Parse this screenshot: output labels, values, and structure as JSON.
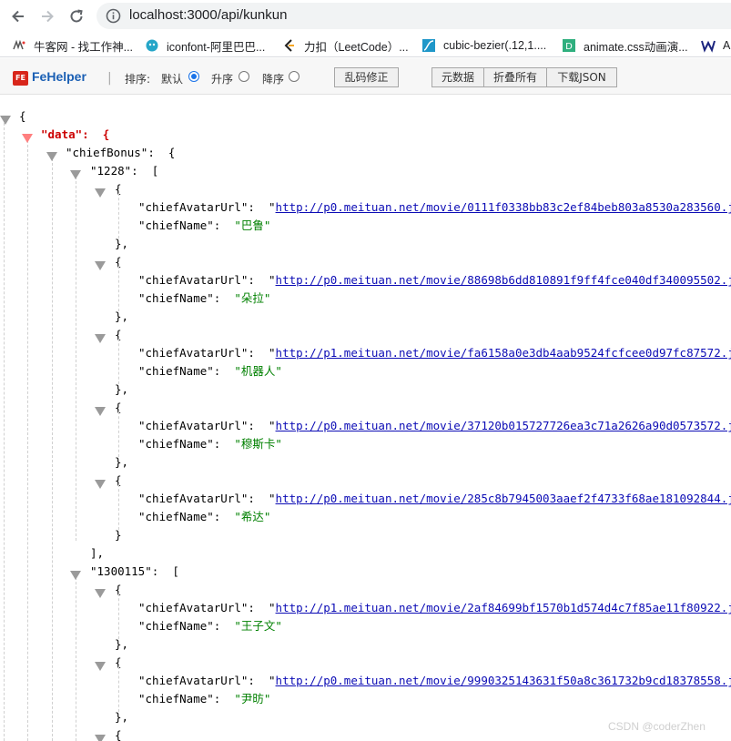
{
  "browser": {
    "url": "localhost:3000/api/kunkun",
    "bookmarks": [
      {
        "label": "牛客网 - 找工作神...",
        "icon": "nowcoder-icon"
      },
      {
        "label": "iconfont-阿里巴巴...",
        "icon": "iconfont-icon"
      },
      {
        "label": "力扣（LeetCode）...",
        "icon": "leetcode-icon"
      },
      {
        "label": "cubic-bezier(.12,1....",
        "icon": "cubic-bezier-icon"
      },
      {
        "label": "animate.css动画演...",
        "icon": "animate-css-icon"
      },
      {
        "label": "A",
        "icon": "w-icon"
      }
    ]
  },
  "fehelper": {
    "logo": "FE",
    "name": "FeHelper",
    "separator": "|",
    "sort_label": "排序:",
    "sort_default": "默认",
    "sort_asc": "升序",
    "sort_desc": "降序",
    "selected_sort": "默认",
    "btn_fix": "乱码修正",
    "btn_raw": "元数据",
    "btn_fold": "折叠所有",
    "btn_download": "下载JSON"
  },
  "json": {
    "root_open": "{",
    "data_key": "\"data\"",
    "data_open": "{",
    "chief_key": "\"chiefBonus\"",
    "chief_open": "{",
    "groups": [
      {
        "key": "\"1228\"",
        "items": [
          {
            "url": "http://p0.meituan.net/movie/0111f0338bb83c2ef84beb803a8530a283560.jpg",
            "name": "\"巴鲁\""
          },
          {
            "url": "http://p0.meituan.net/movie/88698b6dd810891f9ff4fce040df340095502.jpg",
            "name": "\"朵拉\""
          },
          {
            "url": "http://p1.meituan.net/movie/fa6158a0e3db4aab9524fcfcee0d97fc87572.jpg",
            "name": "\"机器人\""
          },
          {
            "url": "http://p0.meituan.net/movie/37120b015727726ea3c71a2626a90d0573572.jpg",
            "name": "\"穆斯卡\""
          },
          {
            "url": "http://p0.meituan.net/movie/285c8b7945003aaef2f4733f68ae181092844.jpg",
            "name": "\"希达\""
          }
        ]
      },
      {
        "key": "\"1300115\"",
        "items": [
          {
            "url": "http://p1.meituan.net/movie/2af84699bf1570b1d574d4c7f85ae11f80922.jpg",
            "name": "\"王子文\""
          },
          {
            "url": "http://p0.meituan.net/movie/9990325143631f50a8c361732b9cd18378558.jpg",
            "name": "\"尹昉\""
          },
          {
            "url": "http://p0.meituan.net/movie/e481a89dcd6dffa50c5eb6a36903a41875399.jpg",
            "name": ""
          }
        ]
      }
    ],
    "avatar_key": "\"chiefAvatarUrl\"",
    "name_key": "\"chiefName\"",
    "colon": ":",
    "comma": ",",
    "obj_open": "{",
    "obj_close": "}",
    "obj_close_comma": "},",
    "arr_open": "[",
    "arr_close_comma": "],"
  },
  "watermark": "CSDN @coderZhen"
}
